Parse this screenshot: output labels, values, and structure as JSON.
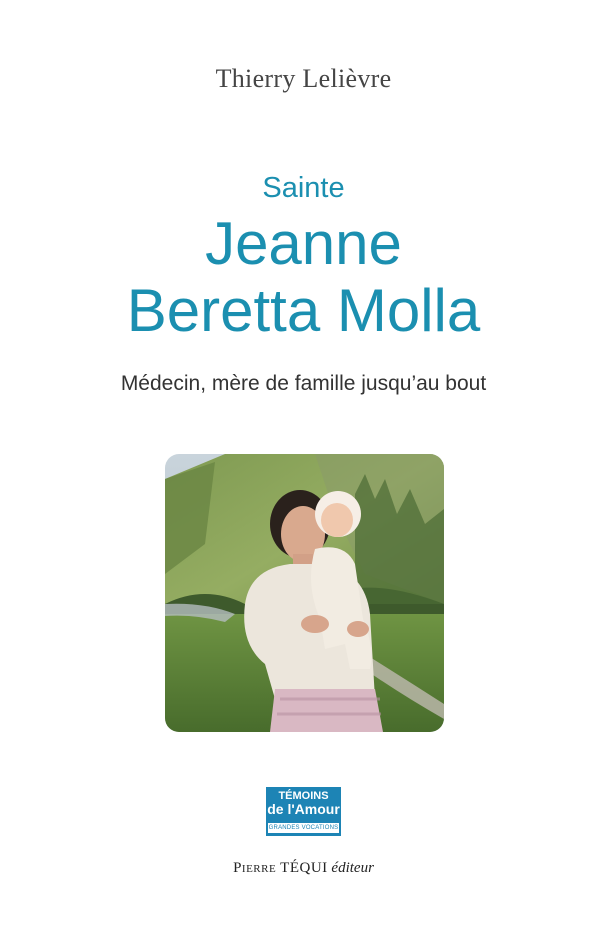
{
  "cover": {
    "author": "Thierry Lelièvre",
    "title_prefix": "Sainte",
    "title_line1": "Jeanne",
    "title_line2": "Beretta Molla",
    "subtitle": "Médecin, mère de famille jusqu’au bout"
  },
  "collection_logo": {
    "line1": "TÉMOINS",
    "line2": "de l'Amour",
    "strip": "GRANDES VOCATIONS",
    "color": "#1d84b5"
  },
  "publisher": {
    "name": "Pierre TÉQUI",
    "suffix": "éditeur"
  },
  "colors": {
    "title": "#1b8fb0",
    "author": "#454545",
    "subtitle": "#333333"
  }
}
